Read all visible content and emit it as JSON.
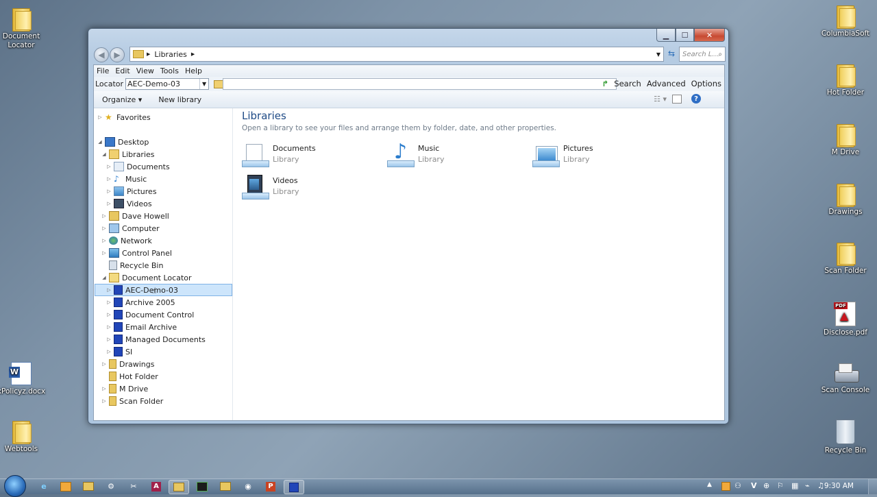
{
  "desktop_icons": {
    "doc_locator": "Document\nLocator",
    "policy": "xPolicyz.docx",
    "webtools": "Webtools",
    "columbiasoft": "ColumbiaSoft",
    "hot_folder": "Hot Folder",
    "m_drive": "M Drive",
    "drawings": "Drawings",
    "scan_folder": "Scan Folder",
    "disclose": "Disclose.pdf",
    "scan_console": "Scan Console",
    "recycle_bin": "Recycle Bin"
  },
  "window": {
    "address": {
      "path": "Libraries",
      "search_placeholder": "Search L..."
    },
    "menu": [
      "File",
      "Edit",
      "View",
      "Tools",
      "Help"
    ],
    "locator": {
      "label": "Locator",
      "value": "AEC-Demo-03",
      "search": "Search",
      "advanced": "Advanced",
      "options": "Options"
    },
    "toolbar": {
      "organize": "Organize ▾",
      "new_library": "New library"
    },
    "tree": {
      "favorites": "Favorites",
      "desktop": "Desktop",
      "libraries": "Libraries",
      "documents": "Documents",
      "music": "Music",
      "pictures": "Pictures",
      "videos": "Videos",
      "dave_howell": "Dave Howell",
      "computer": "Computer",
      "network": "Network",
      "control_panel": "Control Panel",
      "recycle_bin": "Recycle Bin",
      "document_locator": "Document Locator",
      "aec_demo": "AEC-Demo-03",
      "archive_2005": "Archive 2005",
      "document_control": "Document Control",
      "email_archive": "Email Archive",
      "managed_documents": "Managed Documents",
      "si": "SI",
      "drawings": "Drawings",
      "hot_folder": "Hot Folder",
      "m_drive": "M Drive",
      "scan_folder": "Scan Folder"
    },
    "content": {
      "title": "Libraries",
      "subtitle": "Open a library to see your files and arrange them by folder, date, and other properties.",
      "items": [
        {
          "name": "Documents",
          "type": "Library"
        },
        {
          "name": "Music",
          "type": "Library"
        },
        {
          "name": "Pictures",
          "type": "Library"
        },
        {
          "name": "Videos",
          "type": "Library"
        }
      ]
    }
  },
  "taskbar": {
    "time": "9:30 AM"
  }
}
